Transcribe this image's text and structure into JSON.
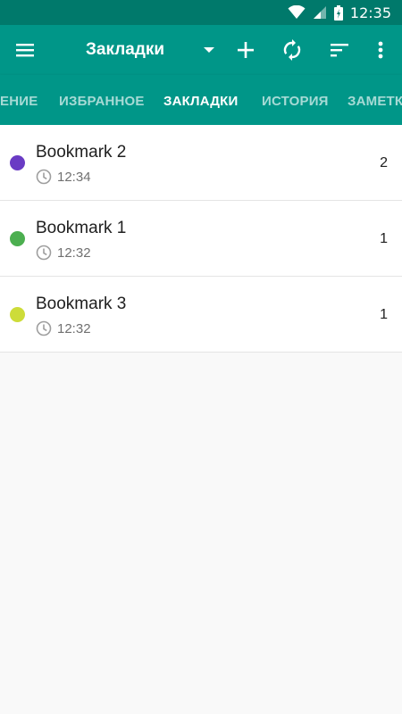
{
  "status": {
    "time": "12:35"
  },
  "appbar": {
    "title": "Закладки"
  },
  "tabs": [
    {
      "label": "ЕНИЕ",
      "active": false
    },
    {
      "label": "ИЗБРАННОЕ",
      "active": false
    },
    {
      "label": "ЗАКЛАДКИ",
      "active": true
    },
    {
      "label": "ИСТОРИЯ",
      "active": false
    },
    {
      "label": "ЗАМЕТК",
      "active": false
    }
  ],
  "bookmarks": [
    {
      "title": "Bookmark 2",
      "time": "12:34",
      "count": "2",
      "color": "#6a3bc4"
    },
    {
      "title": "Bookmark 1",
      "time": "12:32",
      "count": "1",
      "color": "#4caf50"
    },
    {
      "title": "Bookmark 3",
      "time": "12:32",
      "count": "1",
      "color": "#cddc39"
    }
  ],
  "colors": {
    "statusbar": "#00796b",
    "appbar": "#009688",
    "background": "#f9f9f9"
  },
  "icons": [
    "wifi-icon",
    "signal-icon",
    "battery-icon",
    "menu-icon",
    "dropdown-arrow-icon",
    "add-icon",
    "sync-icon",
    "sort-icon",
    "more-vert-icon",
    "clock-icon"
  ]
}
